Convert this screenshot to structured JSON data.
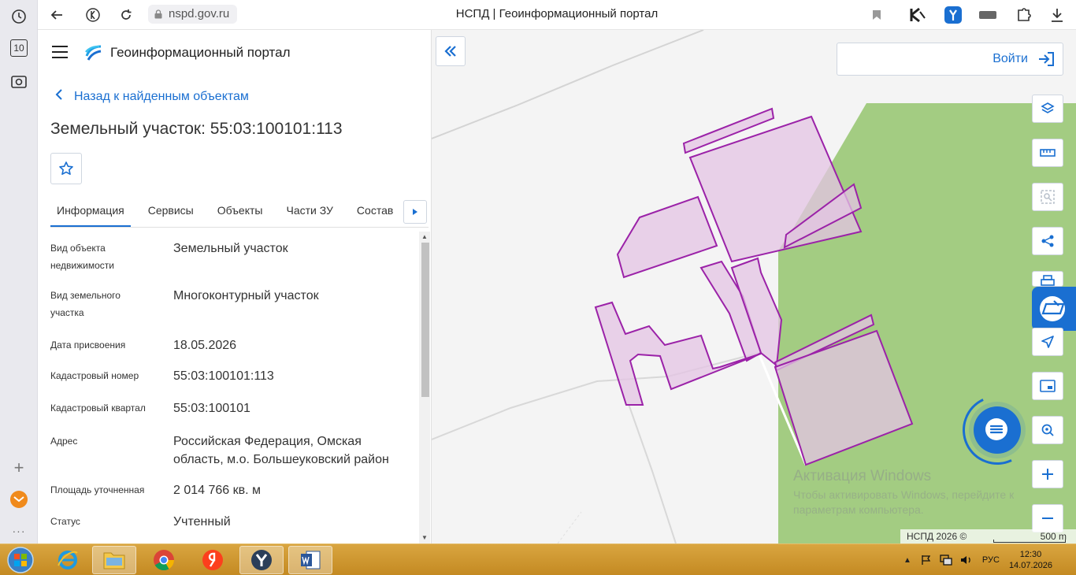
{
  "browser": {
    "url": "nspd.gov.ru",
    "tab_title": "НСПД | Геоинформационный портал",
    "rail_badge": "10"
  },
  "panel": {
    "portal_title": "Геоинформационный портал",
    "back_link": "Назад к найденным объектам",
    "parcel_title": "Земельный участок: 55:03:100101:113",
    "tabs": [
      {
        "label": "Информация",
        "active": true
      },
      {
        "label": "Сервисы"
      },
      {
        "label": "Объекты"
      },
      {
        "label": "Части ЗУ"
      },
      {
        "label": "Состав"
      }
    ],
    "info": [
      {
        "label": "Вид объекта недвижимости",
        "value": "Земельный участок"
      },
      {
        "label": "Вид земельного участка",
        "value": "Многоконтурный участок"
      },
      {
        "label": "Дата присвоения",
        "value": "18.05.2026"
      },
      {
        "label": "Кадастровый номер",
        "value": "55:03:100101:113"
      },
      {
        "label": "Кадастровый квартал",
        "value": "55:03:100101"
      },
      {
        "label": "Адрес",
        "value": "Российская Федерация, Омская область, м.о. Большеуковский район"
      },
      {
        "label": "Площадь уточненная",
        "value": "2 014 766 кв. м"
      },
      {
        "label": "Статус",
        "value": "Учтенный"
      }
    ]
  },
  "map": {
    "login_label": "Войти",
    "watermark_title": "Активация Windows",
    "watermark_sub": "Чтобы активировать Windows, перейдите к параметрам компьютера.",
    "copyright": "НСПД 2026 ©",
    "scale_label": "500 m",
    "colors": {
      "forest": "#a3cc82",
      "parcel_fill": "#e4c4e4",
      "parcel_stroke": "#9b22a8",
      "accent": "#1a6fd1"
    }
  },
  "taskbar": {
    "lang": "РУС",
    "time": "12:30",
    "date": "14.07.2026"
  }
}
